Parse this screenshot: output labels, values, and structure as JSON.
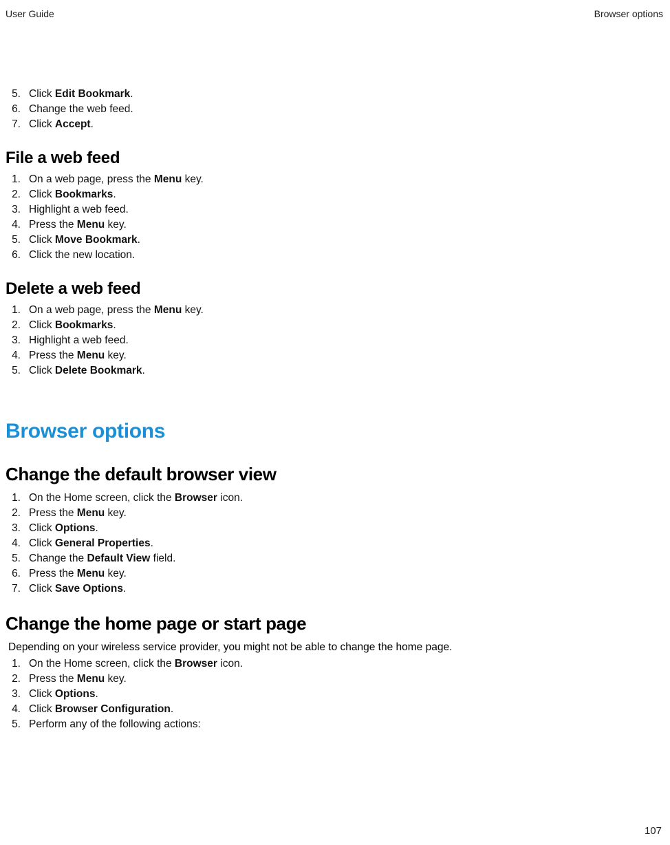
{
  "header": {
    "left": "User Guide",
    "right": "Browser options"
  },
  "s0": {
    "items": [
      {
        "n": "5.",
        "pre": "Click ",
        "bold": "Edit Bookmark",
        "post": "."
      },
      {
        "n": "6.",
        "pre": "Change the web feed.",
        "bold": "",
        "post": ""
      },
      {
        "n": "7.",
        "pre": "Click ",
        "bold": "Accept",
        "post": "."
      }
    ]
  },
  "s1": {
    "heading": "File a web feed",
    "items": [
      {
        "n": "1.",
        "pre": "On a web page, press the ",
        "bold": "Menu",
        "post": " key."
      },
      {
        "n": "2.",
        "pre": "Click ",
        "bold": "Bookmarks",
        "post": "."
      },
      {
        "n": "3.",
        "pre": "Highlight a web feed.",
        "bold": "",
        "post": ""
      },
      {
        "n": "4.",
        "pre": "Press the ",
        "bold": "Menu",
        "post": " key."
      },
      {
        "n": "5.",
        "pre": "Click ",
        "bold": "Move Bookmark",
        "post": "."
      },
      {
        "n": "6.",
        "pre": "Click the new location.",
        "bold": "",
        "post": ""
      }
    ]
  },
  "s2": {
    "heading": "Delete a web feed",
    "items": [
      {
        "n": "1.",
        "pre": "On a web page, press the ",
        "bold": "Menu",
        "post": " key."
      },
      {
        "n": "2.",
        "pre": "Click ",
        "bold": "Bookmarks",
        "post": "."
      },
      {
        "n": "3.",
        "pre": "Highlight a web feed.",
        "bold": "",
        "post": ""
      },
      {
        "n": "4.",
        "pre": "Press the ",
        "bold": "Menu",
        "post": " key."
      },
      {
        "n": "5.",
        "pre": "Click ",
        "bold": "Delete Bookmark",
        "post": "."
      }
    ]
  },
  "s3": {
    "heading": "Browser options"
  },
  "s4": {
    "heading": "Change the default browser view",
    "items": [
      {
        "n": "1.",
        "pre": "On the Home screen, click the ",
        "bold": "Browser",
        "post": " icon."
      },
      {
        "n": "2.",
        "pre": "Press the ",
        "bold": "Menu",
        "post": " key."
      },
      {
        "n": "3.",
        "pre": "Click ",
        "bold": "Options",
        "post": "."
      },
      {
        "n": "4.",
        "pre": "Click ",
        "bold": "General Properties",
        "post": "."
      },
      {
        "n": "5.",
        "pre": "Change the ",
        "bold": "Default View",
        "post": " field."
      },
      {
        "n": "6.",
        "pre": "Press the ",
        "bold": "Menu",
        "post": " key."
      },
      {
        "n": "7.",
        "pre": "Click ",
        "bold": "Save Options",
        "post": "."
      }
    ]
  },
  "s5": {
    "heading": "Change the home page or start page",
    "intro": "Depending on your wireless service provider, you might not be able to change the home page.",
    "items": [
      {
        "n": "1.",
        "pre": "On the Home screen, click the ",
        "bold": "Browser",
        "post": " icon."
      },
      {
        "n": "2.",
        "pre": "Press the ",
        "bold": "Menu",
        "post": " key."
      },
      {
        "n": "3.",
        "pre": "Click ",
        "bold": "Options",
        "post": "."
      },
      {
        "n": "4.",
        "pre": "Click ",
        "bold": "Browser Configuration",
        "post": "."
      },
      {
        "n": "5.",
        "pre": "Perform any of the following actions:",
        "bold": "",
        "post": ""
      }
    ]
  },
  "page_number": "107"
}
